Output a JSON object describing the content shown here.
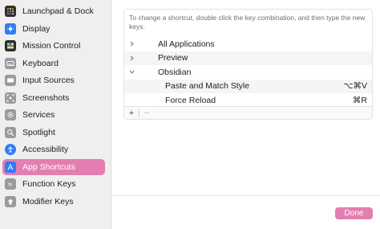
{
  "sidebar": {
    "items": [
      {
        "label": "Launchpad & Dock",
        "icon": "launchpad-grid-icon",
        "icon_color": "#2f2f33"
      },
      {
        "label": "Display",
        "icon": "display-icon",
        "icon_color": "#2e7cf6"
      },
      {
        "label": "Mission Control",
        "icon": "mission-control-icon",
        "icon_color": "#2c2c30"
      },
      {
        "label": "Keyboard",
        "icon": "keyboard-icon",
        "icon_color": "#9a9a9e"
      },
      {
        "label": "Input Sources",
        "icon": "input-sources-icon",
        "icon_color": "#9a9a9e"
      },
      {
        "label": "Screenshots",
        "icon": "screenshot-icon",
        "icon_color": "#9a9a9e"
      },
      {
        "label": "Services",
        "icon": "gear-icon",
        "icon_color": "#9a9a9e"
      },
      {
        "label": "Spotlight",
        "icon": "search-icon",
        "icon_color": "#9a9a9e"
      },
      {
        "label": "Accessibility",
        "icon": "accessibility-icon",
        "icon_color": "#2e7cf6"
      },
      {
        "label": "App Shortcuts",
        "icon": "app-store-icon",
        "icon_color": "#2e7cf6",
        "active": true
      },
      {
        "label": "Function Keys",
        "icon": "fn-key-icon",
        "icon_color": "#9a9a9e"
      },
      {
        "label": "Modifier Keys",
        "icon": "modifier-keys-icon",
        "icon_color": "#9a9a9e"
      }
    ]
  },
  "main": {
    "description": "To change a shortcut, double click the key combination, and then type the new keys.",
    "rows": [
      {
        "label": "All Applications",
        "expanded": false
      },
      {
        "label": "Preview",
        "expanded": false
      },
      {
        "label": "Obsidian",
        "expanded": true
      },
      {
        "label": "Paste and Match Style",
        "key": "⌥⌘V"
      },
      {
        "label": "Force Reload",
        "key": "⌘R"
      }
    ],
    "toolbar": {
      "add_label": "+",
      "remove_label": "−"
    }
  },
  "footer": {
    "done_label": "Done"
  },
  "colors": {
    "accent": "#e37fb0",
    "sidebar_bg": "#f0efee",
    "row_alt": "#f5f5f5"
  }
}
